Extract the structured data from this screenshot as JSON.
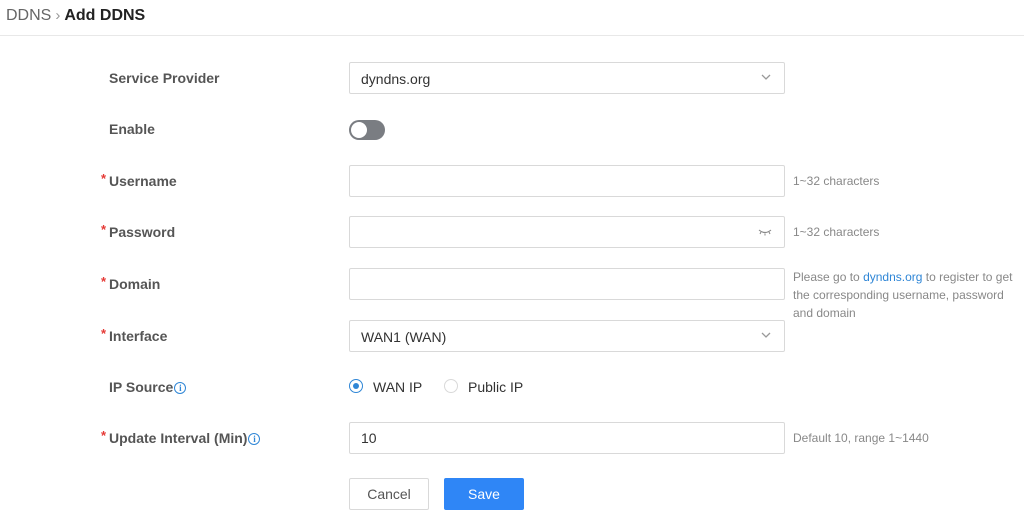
{
  "breadcrumb": {
    "parent": "DDNS",
    "separator": "›",
    "current": "Add DDNS"
  },
  "form": {
    "service_provider": {
      "label": "Service Provider",
      "value": "dyndns.org"
    },
    "enable": {
      "label": "Enable",
      "state": "off"
    },
    "username": {
      "label": "Username",
      "value": "",
      "hint": "1~32 characters"
    },
    "password": {
      "label": "Password",
      "value": "",
      "hint": "1~32 characters"
    },
    "domain": {
      "label": "Domain",
      "value": "",
      "hint_pre": "Please go to ",
      "hint_link": "dyndns.org",
      "hint_post": " to register to get the corresponding username, password and domain"
    },
    "interface": {
      "label": "Interface",
      "value": "WAN1 (WAN)"
    },
    "ip_source": {
      "label": "IP Source",
      "options": [
        {
          "label": "WAN IP",
          "checked": true
        },
        {
          "label": "Public IP",
          "checked": false
        }
      ]
    },
    "update_interval": {
      "label": "Update Interval (Min)",
      "value": "10",
      "hint": "Default 10, range 1~1440"
    }
  },
  "required_marker": "*",
  "info_glyph": "i",
  "buttons": {
    "cancel": "Cancel",
    "save": "Save"
  },
  "colors": {
    "accent": "#2f86f6",
    "required": "#e53935",
    "toggle_off": "#7a7d82",
    "link": "#2f86d6"
  }
}
